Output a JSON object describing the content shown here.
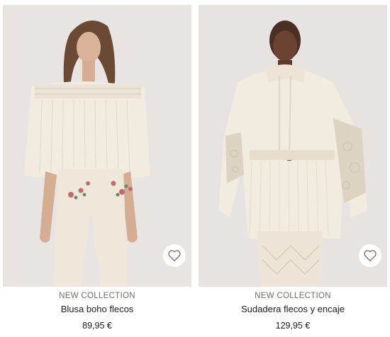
{
  "products": [
    {
      "collection_tag": "NEW COLLECTION",
      "name": "Blusa boho flecos",
      "price": "89,95 €",
      "favorite_icon": "heart-outline-icon"
    },
    {
      "collection_tag": "NEW COLLECTION",
      "name": "Sudadera flecos y encaje",
      "price": "129,95 €",
      "favorite_icon": "heart-outline-icon"
    }
  ],
  "colors": {
    "photo_background": "#e6e3e0",
    "garment_cream": "#f1ebe0",
    "text_primary": "#1e1e1e",
    "text_secondary": "#6e6e6e"
  }
}
